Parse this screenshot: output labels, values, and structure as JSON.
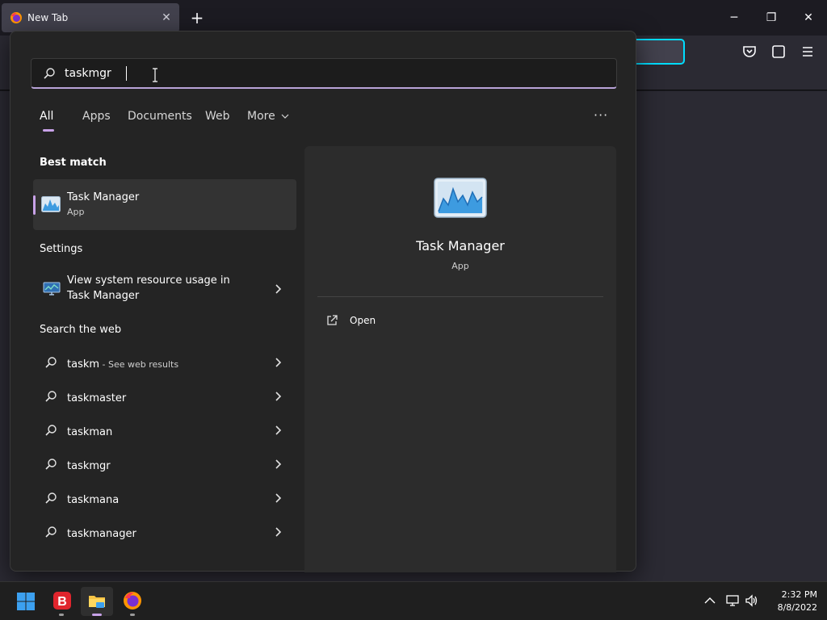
{
  "browser": {
    "tab_title": "New Tab",
    "newtab_label": "+",
    "window_controls": {
      "minimize": "─",
      "maximize": "❐",
      "close": "✕"
    }
  },
  "search": {
    "query": "taskmgr",
    "filters": [
      "All",
      "Apps",
      "Documents",
      "Web",
      "More"
    ],
    "active_filter": "All",
    "more_options": "···"
  },
  "results": {
    "best_match_heading": "Best match",
    "best_match": {
      "title": "Task Manager",
      "type": "App"
    },
    "settings_heading": "Settings",
    "settings_item": {
      "line1": "View system resource usage in",
      "line2": "Task Manager"
    },
    "web_heading": "Search the web",
    "web_items": [
      {
        "text": "taskm",
        "hint": " - See web results"
      },
      {
        "text": "taskmaster"
      },
      {
        "text": "taskman"
      },
      {
        "text": "taskmgr"
      },
      {
        "text": "taskmana"
      },
      {
        "text": "taskmanager"
      }
    ]
  },
  "preview": {
    "title": "Task Manager",
    "type": "App",
    "open_label": "Open"
  },
  "taskbar": {
    "time": "2:32 PM",
    "date": "8/8/2022"
  },
  "colors": {
    "accent": "#c8a2e8",
    "urlbar_focus": "#00ddff",
    "panel_bg": "#242424"
  }
}
